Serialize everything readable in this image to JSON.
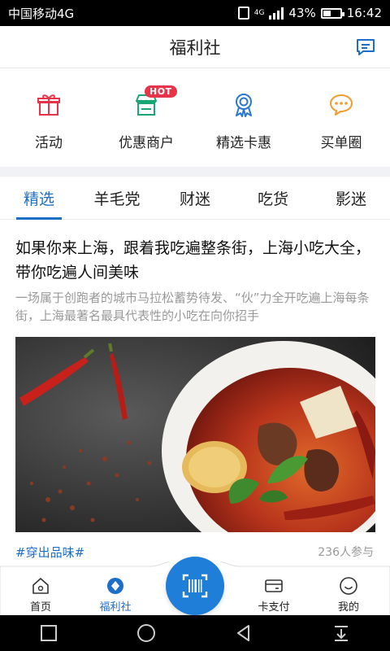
{
  "status_bar": {
    "carrier": "中国移动4G",
    "network": "4G",
    "battery": "43%",
    "time": "16:42"
  },
  "header": {
    "title": "福利社",
    "message_icon": "message-icon"
  },
  "quick_nav": [
    {
      "label": "活动",
      "icon": "gift-icon"
    },
    {
      "label": "优惠商户",
      "icon": "store-icon",
      "badge": "HOT"
    },
    {
      "label": "精选卡惠",
      "icon": "award-icon"
    },
    {
      "label": "买单圈",
      "icon": "chat-icon"
    }
  ],
  "tabs": [
    {
      "label": "精选",
      "active": true
    },
    {
      "label": "羊毛党",
      "active": false
    },
    {
      "label": "财迷",
      "active": false
    },
    {
      "label": "吃货",
      "active": false
    },
    {
      "label": "影迷",
      "active": false
    }
  ],
  "article": {
    "title": "如果你来上海，跟着我吃遍整条街，上海小吃大全，带你吃遍人间美味",
    "description": "一场属于创跑者的城市马拉松蓄势待发、“伙”力全开吃遍上海每条街，上海最著名最具代表性的小吃在向你招手",
    "tag": "#穿出品味#",
    "participants": "236人参与"
  },
  "bottom_bar": {
    "items": [
      {
        "label": "首页",
        "icon": "home-icon",
        "active": false
      },
      {
        "label": "福利社",
        "icon": "welfare-icon",
        "active": true
      },
      {
        "label": "卡支付",
        "icon": "card-icon",
        "active": false
      },
      {
        "label": "我的",
        "icon": "smile-icon",
        "active": false
      }
    ],
    "center_icon": "scan-icon"
  },
  "colors": {
    "accent": "#1b6fc8",
    "gift": "#e8344a",
    "store": "#1aa574",
    "award": "#2b78d0",
    "chat": "#f29a2e",
    "hot_badge": "#e8344a"
  }
}
